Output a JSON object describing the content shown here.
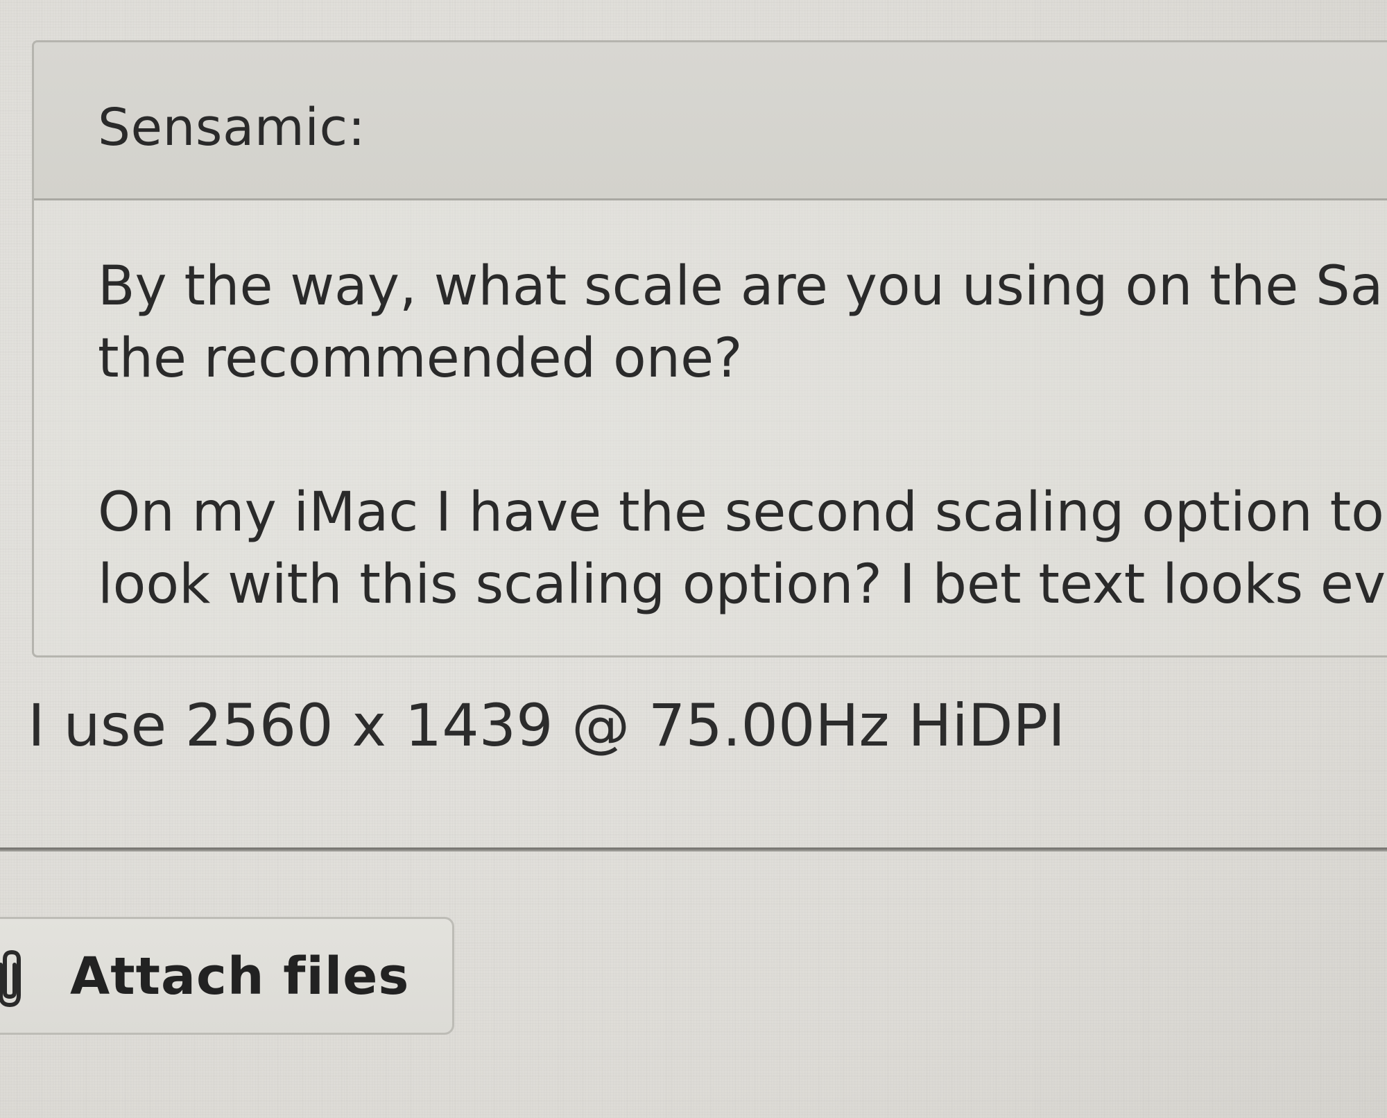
{
  "quote": {
    "author": "Sensamic:",
    "paragraphs": [
      {
        "line1": "By the way, what scale are you using on the Sa",
        "line2": "the recommended one?"
      },
      {
        "line1": "On my iMac I have the second scaling option to",
        "line2": "look with this scaling option? I bet text looks ev"
      }
    ]
  },
  "reply": {
    "text": "I use 2560 x 1439 @ 75.00Hz HiDPI"
  },
  "toolbar": {
    "attach_label": "Attach files",
    "attach_icon": "paperclip-icon"
  }
}
